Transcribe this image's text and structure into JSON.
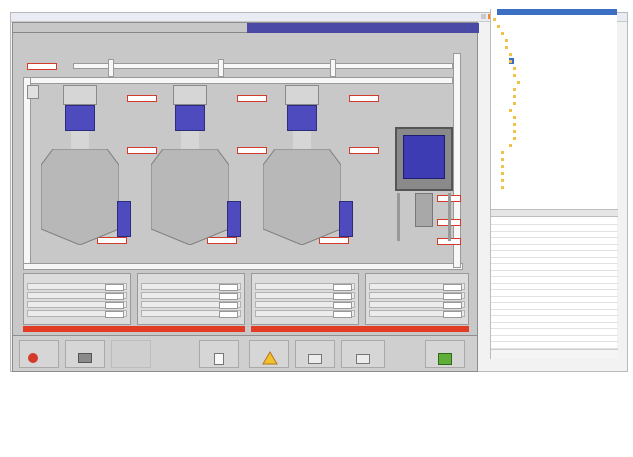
{
  "window": {
    "title": ""
  },
  "hmi": {
    "tabs": [
      {
        "label": ""
      },
      {
        "label": ""
      }
    ],
    "callouts": [
      "",
      "",
      "",
      "",
      "",
      "",
      "",
      "",
      "",
      "",
      "",
      "",
      ""
    ],
    "panels": [
      {
        "title": "",
        "rows": [
          "",
          "",
          "",
          ""
        ],
        "values": [
          "",
          "",
          "",
          ""
        ]
      },
      {
        "title": "",
        "rows": [
          "",
          "",
          "",
          ""
        ],
        "values": [
          "",
          "",
          "",
          ""
        ]
      },
      {
        "title": "",
        "rows": [
          "",
          "",
          "",
          ""
        ],
        "values": [
          "",
          "",
          "",
          ""
        ]
      },
      {
        "title": "",
        "rows": [
          "",
          "",
          "",
          ""
        ],
        "values": [
          "",
          "",
          "",
          ""
        ]
      }
    ],
    "buttons": [
      "",
      "",
      "",
      "",
      "",
      "",
      "",
      ""
    ]
  },
  "sidebar": {
    "tree": [
      "",
      "",
      "",
      "",
      "",
      "",
      "",
      "",
      "",
      "",
      "",
      "",
      "",
      "",
      "",
      "",
      "",
      "",
      "",
      "",
      "",
      "",
      "",
      "",
      ""
    ],
    "properties_title": "",
    "properties": [
      "",
      "",
      "",
      "",
      "",
      "",
      "",
      "",
      "",
      "",
      "",
      "",
      "",
      "",
      "",
      "",
      "",
      "",
      "",
      ""
    ],
    "footer": ""
  },
  "colors": {
    "tab_active": "#4a4aa6",
    "tank_fill": "#4d4bbd",
    "alarm": "#e23b26",
    "hmi_background": "#c8c8c8"
  }
}
